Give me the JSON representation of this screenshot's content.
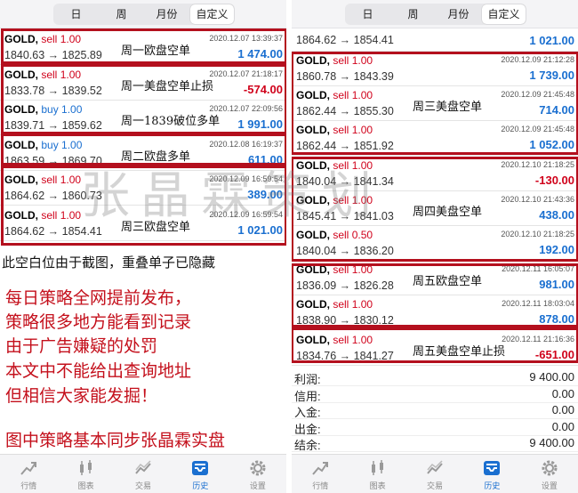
{
  "segment_tabs": [
    "日",
    "周",
    "月份",
    "自定义"
  ],
  "left_trades": [
    {
      "symbol": "GOLD,",
      "side": "sell",
      "lots": "1.00",
      "prices": "1840.63 → 1825.89",
      "time": "2020.12.07 13:39:37",
      "profit": "1 474.00",
      "note": "周一欧盘空单"
    },
    {
      "symbol": "GOLD,",
      "side": "sell",
      "lots": "1.00",
      "prices": "1833.78 → 1839.52",
      "time": "2020.12.07 21:18:17",
      "profit": "-574.00",
      "note": "周一美盘空单止损"
    },
    {
      "symbol": "GOLD,",
      "side": "buy",
      "lots": "1.00",
      "prices": "1839.71 → 1859.62",
      "time": "2020.12.07 22:09:56",
      "profit": "1 991.00",
      "note": "周一1839破位多单"
    },
    {
      "symbol": "GOLD,",
      "side": "buy",
      "lots": "1.00",
      "prices": "1863.59 → 1869.70",
      "time": "2020.12.08 16:19:37",
      "profit": "611.00",
      "note": "周二欧盘多单"
    },
    {
      "symbol": "GOLD,",
      "side": "sell",
      "lots": "1.00",
      "prices": "1864.62 → 1860.73",
      "time": "2020.12.09 16:59:54",
      "profit": "389.00",
      "note": ""
    },
    {
      "symbol": "GOLD,",
      "side": "sell",
      "lots": "1.00",
      "prices": "1864.62 → 1854.41",
      "time": "2020.12.09 16:59:54",
      "profit": "1 021.00",
      "note": "周三欧盘空单"
    }
  ],
  "right_top_partial": {
    "prices": "1864.62 → 1854.41",
    "profit": "1 021.00"
  },
  "right_trades": [
    {
      "symbol": "GOLD,",
      "side": "sell",
      "lots": "1.00",
      "prices": "1860.78 → 1843.39",
      "time": "2020.12.09 21:12:28",
      "profit": "1 739.00",
      "note": ""
    },
    {
      "symbol": "GOLD,",
      "side": "sell",
      "lots": "1.00",
      "prices": "1862.44 → 1855.30",
      "time": "2020.12.09 21:45:48",
      "profit": "714.00",
      "note": "周三美盘空单"
    },
    {
      "symbol": "GOLD,",
      "side": "sell",
      "lots": "1.00",
      "prices": "1862.44 → 1851.92",
      "time": "2020.12.09 21:45:48",
      "profit": "1 052.00",
      "note": ""
    },
    {
      "symbol": "GOLD,",
      "side": "sell",
      "lots": "1.00",
      "prices": "1840.04 → 1841.34",
      "time": "2020.12.10 21:18:25",
      "profit": "-130.00",
      "note": ""
    },
    {
      "symbol": "GOLD,",
      "side": "sell",
      "lots": "1.00",
      "prices": "1845.41 → 1841.03",
      "time": "2020.12.10 21:43:36",
      "profit": "438.00",
      "note": "周四美盘空单"
    },
    {
      "symbol": "GOLD,",
      "side": "sell",
      "lots": "0.50",
      "prices": "1840.04 → 1836.20",
      "time": "2020.12.10 21:18:25",
      "profit": "192.00",
      "note": ""
    },
    {
      "symbol": "GOLD,",
      "side": "sell",
      "lots": "1.00",
      "prices": "1836.09 → 1826.28",
      "time": "2020.12.11 16:05:07",
      "profit": "981.00",
      "note": "周五欧盘空单"
    },
    {
      "symbol": "GOLD,",
      "side": "sell",
      "lots": "1.00",
      "prices": "1838.90 → 1830.12",
      "time": "2020.12.11 18:03:04",
      "profit": "878.00",
      "note": ""
    },
    {
      "symbol": "GOLD,",
      "side": "sell",
      "lots": "1.00",
      "prices": "1834.76 → 1841.27",
      "time": "2020.12.11 21:16:36",
      "profit": "-651.00",
      "note": "周五美盘空单止损"
    }
  ],
  "summary": [
    {
      "label": "利润:",
      "value": "9 400.00"
    },
    {
      "label": "信用:",
      "value": "0.00"
    },
    {
      "label": "入金:",
      "value": "0.00"
    },
    {
      "label": "出金:",
      "value": "0.00"
    },
    {
      "label": "结余:",
      "value": "9 400.00"
    }
  ],
  "hidden_note": "此空白位由于截图，重叠单子已隐藏",
  "promo_lines": [
    "每日策略全网提前发布，",
    "策略很多地方能看到记录",
    "由于广告嫌疑的处罚",
    "本文中不能给出查询地址",
    "但相信大家能发掘！",
    "图中策略基本同步张晶霖实盘"
  ],
  "watermark": "张晶霖策划",
  "tabs": [
    {
      "label": "行情",
      "icon": "quotes-icon"
    },
    {
      "label": "图表",
      "icon": "chart-icon"
    },
    {
      "label": "交易",
      "icon": "trade-icon"
    },
    {
      "label": "历史",
      "icon": "history-icon"
    },
    {
      "label": "设置",
      "icon": "settings-icon"
    }
  ],
  "active_tab": "历史",
  "colors": {
    "sell": "#d0021b",
    "buy": "#1a6fd0",
    "box": "#b4101e",
    "active_tab": "#1a6fd0"
  }
}
